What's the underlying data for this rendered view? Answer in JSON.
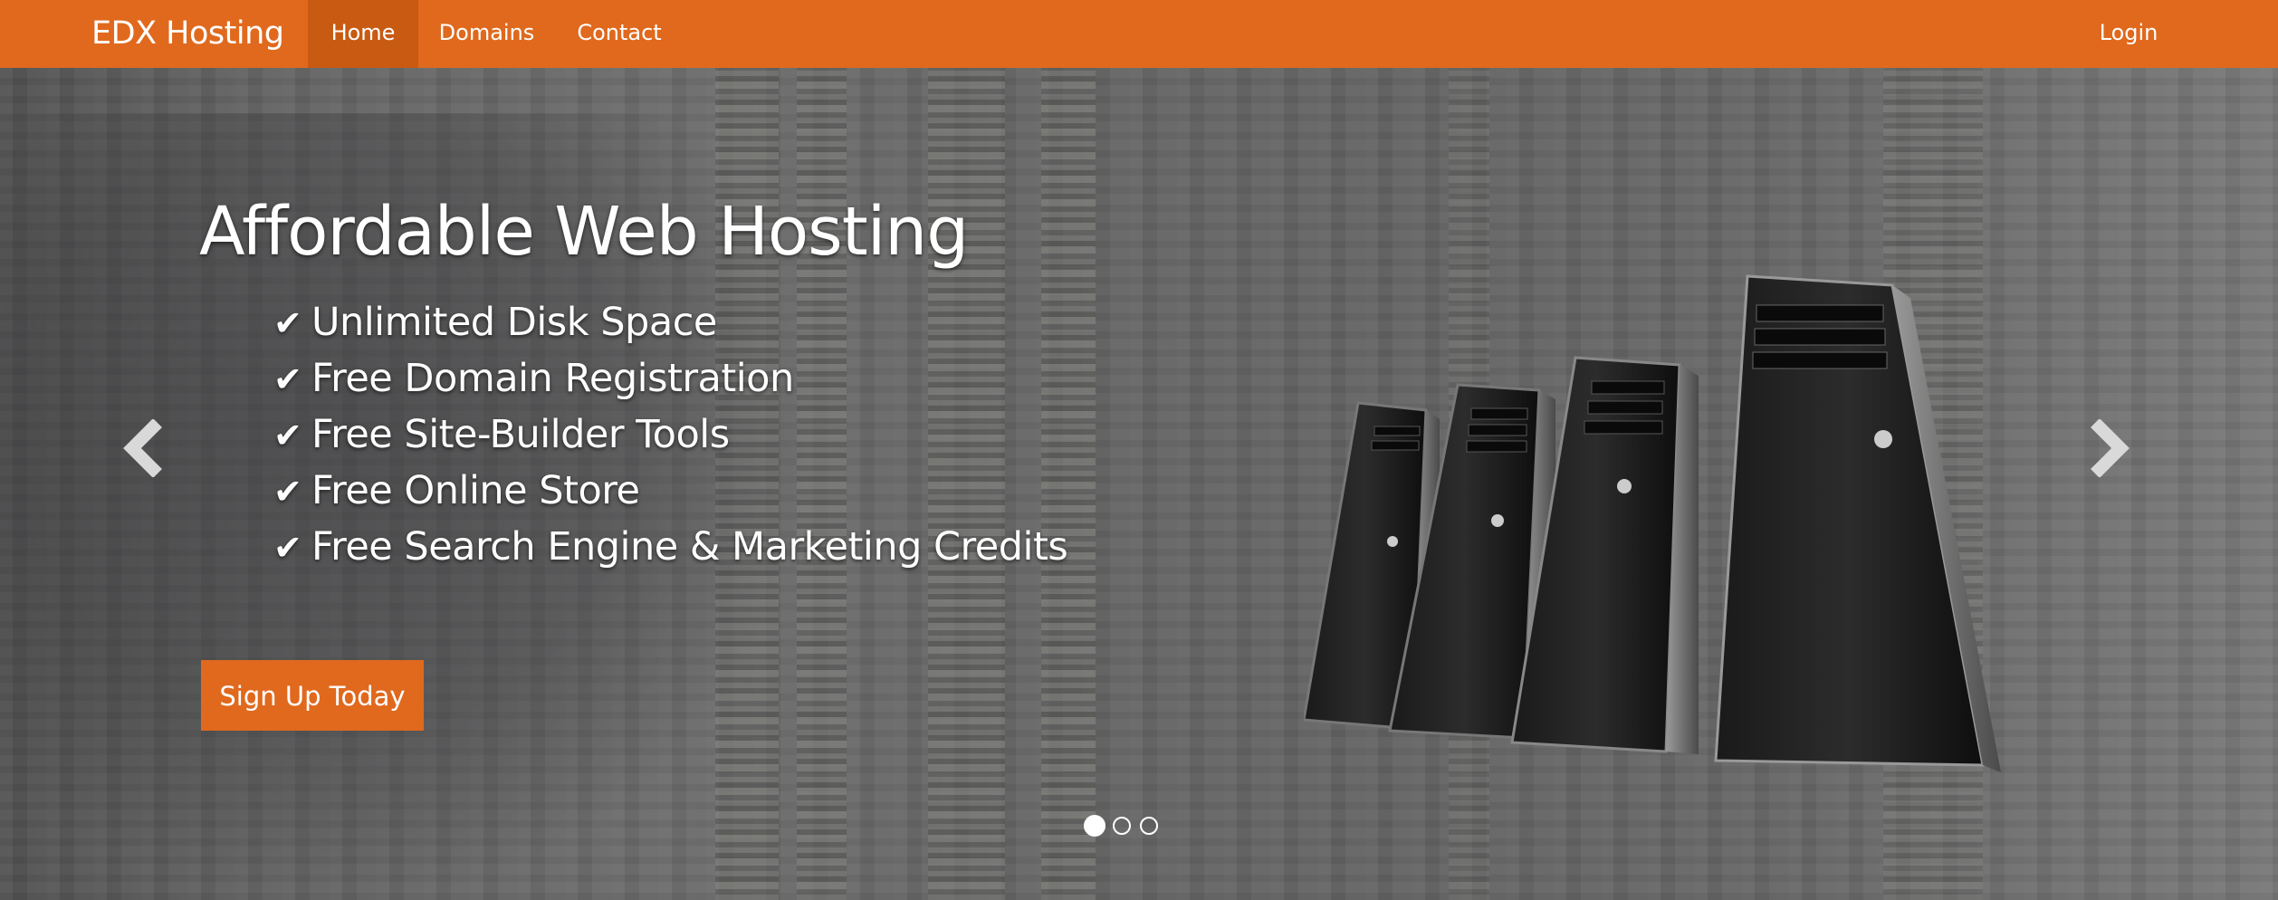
{
  "navbar": {
    "brand": "EDX Hosting",
    "items": [
      {
        "label": "Home",
        "active": true
      },
      {
        "label": "Domains",
        "active": false
      },
      {
        "label": "Contact",
        "active": false
      }
    ],
    "login": "Login",
    "color": "#e0691d",
    "active_color": "#c85a12"
  },
  "hero": {
    "title": "Affordable Web Hosting",
    "features": [
      "Unlimited Disk Space",
      "Free Domain Registration",
      "Free Site-Builder Tools",
      "Free Online Store",
      "Free Search Engine & Marketing Credits"
    ],
    "check_icon": "check-icon",
    "cta": "Sign Up Today",
    "prev_icon": "chevron-left-icon",
    "next_icon": "chevron-right-icon"
  },
  "carousel": {
    "slide_count": 3,
    "active_index": 0
  }
}
